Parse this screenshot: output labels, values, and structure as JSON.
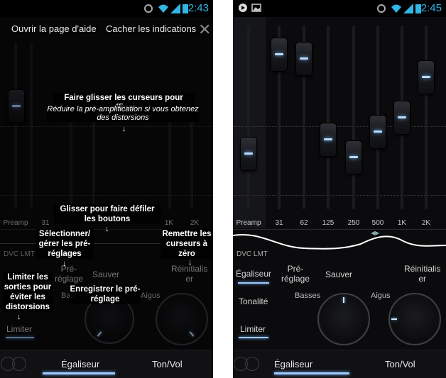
{
  "left": {
    "status_time": "2:43",
    "help_link": "Ouvrir la page d'aide",
    "hide_link": "Cacher les indications",
    "band_labels": [
      "Preamp",
      "31",
      "1K",
      "2K"
    ],
    "dvc": "DVC LMT",
    "menu": {
      "preset": "Pré-\nréglage",
      "save": "Sauver",
      "reset": "Réinitialis\ner",
      "bass": "Bas",
      "treble": "Aigus",
      "limit": "Limiter"
    },
    "tabs": {
      "eq": "Égaliseur",
      "tonvol": "Ton/Vol"
    },
    "hints": {
      "slider_title": "Faire glisser les curseurs pour affiner",
      "slider_sub": "Réduire la pré-amplification si vous obtenez des distorsions",
      "scroll": "Glisser pour faire défiler les boutons",
      "select": "Sélectionner/ gérer les pré-réglages",
      "reset": "Remettre les curseurs à zéro",
      "limit": "Limiter les sorties pour éviter les distorsions",
      "save": "Enregistrer le pré-réglage"
    }
  },
  "right": {
    "status_time": "2:45",
    "band_labels": [
      "Preamp",
      "31",
      "62",
      "125",
      "250",
      "500",
      "1K",
      "2K"
    ],
    "band_levels": [
      0.3,
      0.84,
      0.82,
      0.38,
      0.28,
      0.42,
      0.5,
      0.72
    ],
    "dvc": "DVC LMT",
    "menu": {
      "eq": "Égaliseur",
      "tone": "Tonalité",
      "limit": "Limiter",
      "preset": "Pré-\nréglage",
      "save": "Sauver",
      "reset": "Réinitialis\ner",
      "bass": "Basses",
      "treble": "Aigus"
    },
    "tabs": {
      "eq": "Égaliseur",
      "tonvol": "Ton/Vol"
    }
  },
  "colors": {
    "accent": "#33b5e5",
    "glow": "#9fc9ff",
    "bg": "#0b0b0d"
  }
}
